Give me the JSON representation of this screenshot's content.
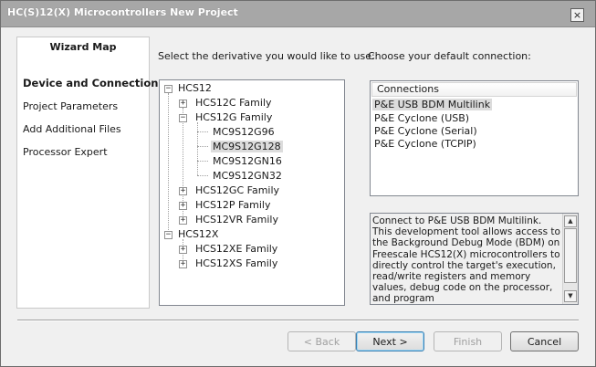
{
  "window": {
    "title": "HC(S)12(X) Microcontrollers New Project",
    "close_glyph": "×"
  },
  "wizard_map": {
    "title": "Wizard Map",
    "items": [
      {
        "label": "Device and Connection",
        "active": true
      },
      {
        "label": "Project Parameters"
      },
      {
        "label": "Add Additional Files"
      },
      {
        "label": "Processor Expert"
      }
    ]
  },
  "derivative": {
    "prompt": "Select the derivative you would like to use:",
    "tree": [
      {
        "label": "HCS12",
        "expander": "−"
      },
      {
        "label": "HCS12C Family",
        "expander": "+"
      },
      {
        "label": "HCS12G Family",
        "expander": "−"
      },
      {
        "label": "MC9S12G96"
      },
      {
        "label": "MC9S12G128",
        "selected": true
      },
      {
        "label": "MC9S12GN16"
      },
      {
        "label": "MC9S12GN32"
      },
      {
        "label": "HCS12GC Family",
        "expander": "+"
      },
      {
        "label": "HCS12P Family",
        "expander": "+"
      },
      {
        "label": "HCS12VR Family",
        "expander": "+"
      },
      {
        "label": "HCS12X",
        "expander": "−"
      },
      {
        "label": "HCS12XE Family",
        "expander": "+"
      },
      {
        "label": "HCS12XS Family",
        "expander": "+"
      }
    ]
  },
  "connection": {
    "prompt": "Choose your default connection:",
    "header": "Connections",
    "items": [
      {
        "label": "P&E USB BDM Multilink",
        "selected": true
      },
      {
        "label": "P&E Cyclone (USB)"
      },
      {
        "label": "P&E Cyclone (Serial)"
      },
      {
        "label": "P&E Cyclone (TCPIP)"
      }
    ],
    "description": "Connect to P&E USB BDM Multilink. This development tool allows access to the Background Debug Mode (BDM) on Freescale HCS12(X) microcontrollers to directly control the target's execution, read/write registers and memory values, debug code on the processor, and program",
    "scroll_up_glyph": "▲",
    "scroll_down_glyph": "▼"
  },
  "buttons": {
    "back": "< Back",
    "next": "Next >",
    "finish": "Finish",
    "cancel": "Cancel"
  }
}
